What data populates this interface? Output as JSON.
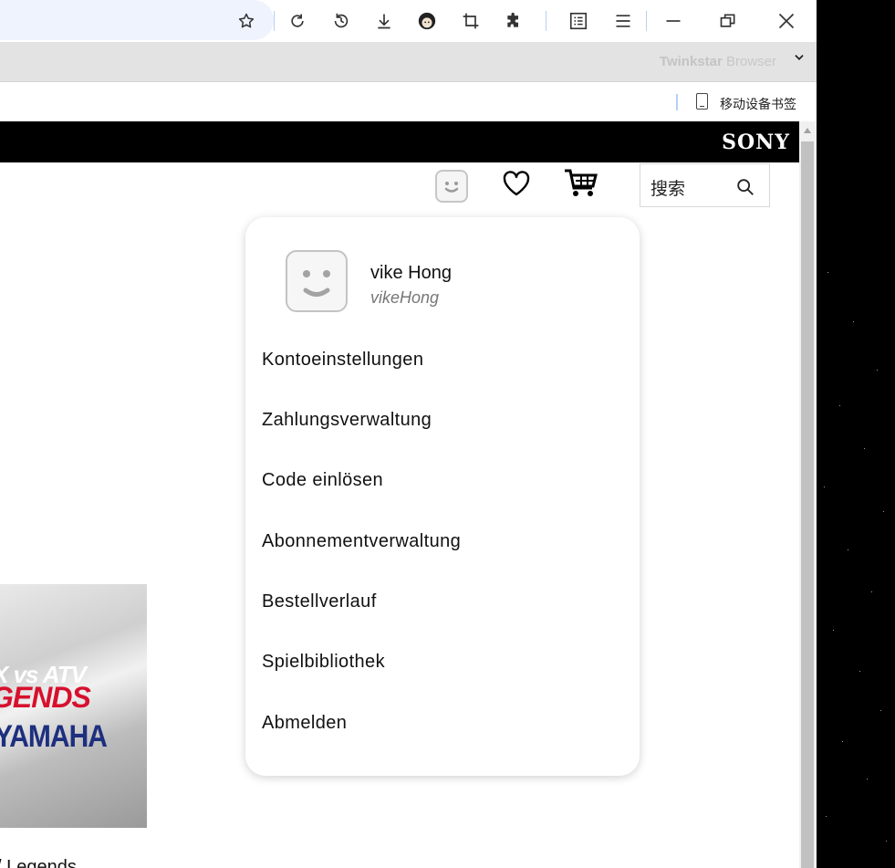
{
  "browser": {
    "profile_name_bold": "Twinkstar",
    "profile_name_rest": "Browser",
    "bookmark_label": "移动设备书签",
    "toolbar_icons": [
      "star-icon",
      "reload-icon",
      "history-icon",
      "download-icon",
      "profile-avatar-icon",
      "crop-icon",
      "extension-icon",
      "reader-icon",
      "menu-icon",
      "minimize-icon",
      "restore-icon",
      "close-icon"
    ]
  },
  "site": {
    "logo": "SONY",
    "search_placeholder": "搜索"
  },
  "account_menu": {
    "display_name": "vike Hong",
    "handle": "vikeHong",
    "items": [
      "Kontoeinstellungen",
      "Zahlungsverwaltung",
      "Code einlösen",
      "Abonnementverwaltung",
      "Bestellverlauf",
      "Spielbibliothek",
      "Abmelden"
    ]
  },
  "game_tile": {
    "logo_line1": "X vs ATV",
    "logo_line2": "GENDS",
    "logo_line3": "YAMAHA",
    "title": "/ Legends"
  },
  "colors": {
    "sony_bar": "#000000",
    "address_bar": "#eef3fd",
    "tab_strip": "#e3e3e3",
    "logo_red": "#d6112d",
    "logo_blue": "#1d2f7e"
  }
}
